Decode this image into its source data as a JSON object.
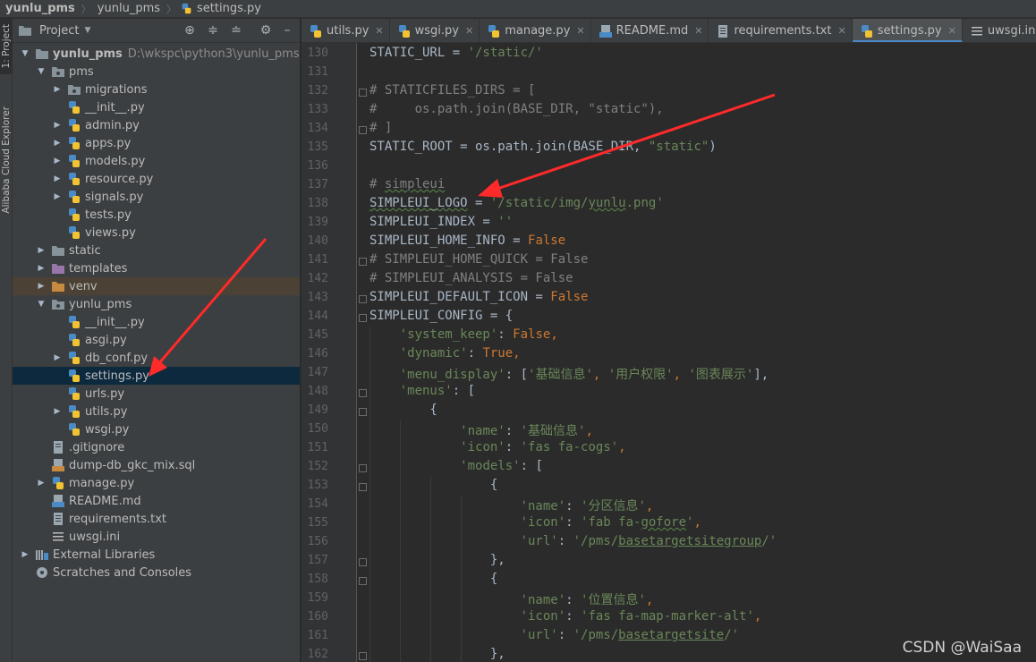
{
  "breadcrumb": [
    "yunlu_pms",
    "yunlu_pms",
    "settings.py"
  ],
  "toolstrip": {
    "project_label": "1: Project",
    "alibaba_label": "Alibaba Cloud Explorer"
  },
  "panel": {
    "title": "Project",
    "tree": [
      {
        "depth": 0,
        "chev": "down",
        "icon": "folder-icon",
        "label": "yunlu_pms",
        "bold": true,
        "path": "D:\\wkspc\\python3\\yunlu_pms"
      },
      {
        "depth": 1,
        "chev": "down",
        "icon": "package-icon",
        "label": "pms"
      },
      {
        "depth": 2,
        "chev": "right",
        "icon": "package-icon",
        "label": "migrations"
      },
      {
        "depth": 2,
        "chev": "",
        "icon": "python-icon",
        "label": "__init__.py"
      },
      {
        "depth": 2,
        "chev": "right",
        "icon": "python-icon",
        "label": "admin.py"
      },
      {
        "depth": 2,
        "chev": "right",
        "icon": "python-icon",
        "label": "apps.py"
      },
      {
        "depth": 2,
        "chev": "right",
        "icon": "python-icon",
        "label": "models.py"
      },
      {
        "depth": 2,
        "chev": "right",
        "icon": "python-icon",
        "label": "resource.py"
      },
      {
        "depth": 2,
        "chev": "right",
        "icon": "python-icon",
        "label": "signals.py"
      },
      {
        "depth": 2,
        "chev": "",
        "icon": "python-icon",
        "label": "tests.py"
      },
      {
        "depth": 2,
        "chev": "",
        "icon": "python-icon",
        "label": "views.py"
      },
      {
        "depth": 1,
        "chev": "right",
        "icon": "folder-icon",
        "label": "static"
      },
      {
        "depth": 1,
        "chev": "right",
        "icon": "template-folder-icon",
        "label": "templates"
      },
      {
        "depth": 1,
        "chev": "right",
        "icon": "excluded-folder-icon",
        "label": "venv",
        "highlight": "venv"
      },
      {
        "depth": 1,
        "chev": "down",
        "icon": "package-icon",
        "label": "yunlu_pms"
      },
      {
        "depth": 2,
        "chev": "",
        "icon": "python-icon",
        "label": "__init__.py"
      },
      {
        "depth": 2,
        "chev": "",
        "icon": "python-icon",
        "label": "asgi.py"
      },
      {
        "depth": 2,
        "chev": "right",
        "icon": "python-icon",
        "label": "db_conf.py"
      },
      {
        "depth": 2,
        "chev": "",
        "icon": "python-icon",
        "label": "settings.py",
        "highlight": "selected"
      },
      {
        "depth": 2,
        "chev": "",
        "icon": "python-icon",
        "label": "urls.py"
      },
      {
        "depth": 2,
        "chev": "right",
        "icon": "python-icon",
        "label": "utils.py"
      },
      {
        "depth": 2,
        "chev": "",
        "icon": "python-icon",
        "label": "wsgi.py"
      },
      {
        "depth": 1,
        "chev": "",
        "icon": "gitignore-icon",
        "label": ".gitignore"
      },
      {
        "depth": 1,
        "chev": "",
        "icon": "sql-icon",
        "label": "dump-db_gkc_mix.sql"
      },
      {
        "depth": 1,
        "chev": "right",
        "icon": "python-icon",
        "label": "manage.py"
      },
      {
        "depth": 1,
        "chev": "",
        "icon": "markdown-icon",
        "label": "README.md"
      },
      {
        "depth": 1,
        "chev": "",
        "icon": "text-file-icon",
        "label": "requirements.txt"
      },
      {
        "depth": 1,
        "chev": "",
        "icon": "ini-file-icon",
        "label": "uwsgi.ini"
      },
      {
        "depth": 0,
        "chev": "right",
        "icon": "libraries-icon",
        "label": "External Libraries"
      },
      {
        "depth": 0,
        "chev": "",
        "icon": "scratches-icon",
        "label": "Scratches and Consoles"
      }
    ]
  },
  "tabs": [
    {
      "label": "utils.py",
      "icon": "python-icon",
      "active": false
    },
    {
      "label": "wsgi.py",
      "icon": "python-icon",
      "active": false
    },
    {
      "label": "manage.py",
      "icon": "python-icon",
      "active": false
    },
    {
      "label": "README.md",
      "icon": "markdown-icon",
      "active": false
    },
    {
      "label": "requirements.txt",
      "icon": "text-file-icon",
      "active": false
    },
    {
      "label": "settings.py",
      "icon": "python-icon",
      "active": true
    },
    {
      "label": "uwsgi.ini",
      "icon": "ini-file-icon",
      "active": false
    }
  ],
  "editor": {
    "lines": [
      {
        "n": "130",
        "tokens": [
          [
            "id",
            "STATIC_URL = "
          ],
          [
            "str",
            "'/static/'"
          ]
        ]
      },
      {
        "n": "131",
        "tokens": []
      },
      {
        "n": "132",
        "fold": true,
        "tokens": [
          [
            "com",
            "# STATICFILES_DIRS = ["
          ]
        ]
      },
      {
        "n": "133",
        "tokens": [
          [
            "com",
            "#     os.path.join(BASE_DIR, \"static\"),"
          ]
        ]
      },
      {
        "n": "134",
        "fold": true,
        "tokens": [
          [
            "com",
            "# ]"
          ]
        ]
      },
      {
        "n": "135",
        "tokens": [
          [
            "id",
            "STATIC_ROOT = os.path.join(BASE_DIR, "
          ],
          [
            "str",
            "\"static\""
          ],
          [
            "id",
            ")"
          ]
        ]
      },
      {
        "n": "136",
        "tokens": []
      },
      {
        "n": "137",
        "tokens": [
          [
            "com",
            "# "
          ],
          [
            "comsq",
            "simpleui"
          ]
        ]
      },
      {
        "n": "138",
        "tokens": [
          [
            "sq",
            "SIMPLEUI_LOGO"
          ],
          [
            "id",
            " = "
          ],
          [
            "str",
            "'/static/img/"
          ],
          [
            "strsq",
            "yunlu"
          ],
          [
            "str",
            ".png'"
          ]
        ]
      },
      {
        "n": "139",
        "tokens": [
          [
            "id",
            "SIMPLEUI_INDEX = "
          ],
          [
            "str",
            "''"
          ]
        ]
      },
      {
        "n": "140",
        "tokens": [
          [
            "id",
            "SIMPLEUI_HOME_INFO = "
          ],
          [
            "kw",
            "False"
          ]
        ]
      },
      {
        "n": "141",
        "fold": true,
        "tokens": [
          [
            "com",
            "# SIMPLEUI_HOME_QUICK = False"
          ]
        ]
      },
      {
        "n": "142",
        "tokens": [
          [
            "com",
            "# SIMPLEUI_ANALYSIS = False"
          ]
        ]
      },
      {
        "n": "143",
        "fold": true,
        "tokens": [
          [
            "id",
            "SIMPLEUI_DEFAULT_ICON = "
          ],
          [
            "kw",
            "False"
          ]
        ]
      },
      {
        "n": "144",
        "fold": true,
        "tokens": [
          [
            "id",
            "SIMPLEUI_CONFIG = {"
          ]
        ]
      },
      {
        "n": "145",
        "tokens": [
          [
            "id",
            "    "
          ],
          [
            "str",
            "'system_keep'"
          ],
          [
            "id",
            ": "
          ],
          [
            "kw",
            "False"
          ],
          [
            "kw",
            ","
          ]
        ]
      },
      {
        "n": "146",
        "tokens": [
          [
            "id",
            "    "
          ],
          [
            "str",
            "'dynamic'"
          ],
          [
            "id",
            ": "
          ],
          [
            "kw",
            "True"
          ],
          [
            "kw",
            ","
          ]
        ]
      },
      {
        "n": "147",
        "tokens": [
          [
            "id",
            "    "
          ],
          [
            "str",
            "'menu_display'"
          ],
          [
            "id",
            ": ["
          ],
          [
            "str",
            "'基础信息'"
          ],
          [
            "kw",
            ", "
          ],
          [
            "str",
            "'用户权限'"
          ],
          [
            "kw",
            ", "
          ],
          [
            "str",
            "'图表展示'"
          ],
          [
            "id",
            "],"
          ]
        ]
      },
      {
        "n": "148",
        "fold": true,
        "tokens": [
          [
            "id",
            "    "
          ],
          [
            "str",
            "'menus'"
          ],
          [
            "id",
            ": ["
          ]
        ]
      },
      {
        "n": "149",
        "fold": true,
        "tokens": [
          [
            "id",
            "        {"
          ]
        ]
      },
      {
        "n": "150",
        "tokens": [
          [
            "id",
            "            "
          ],
          [
            "str",
            "'name'"
          ],
          [
            "id",
            ": "
          ],
          [
            "str",
            "'基础信息'"
          ],
          [
            "kw",
            ","
          ]
        ]
      },
      {
        "n": "151",
        "tokens": [
          [
            "id",
            "            "
          ],
          [
            "str",
            "'icon'"
          ],
          [
            "id",
            ": "
          ],
          [
            "str",
            "'fas fa-cogs'"
          ],
          [
            "kw",
            ","
          ]
        ]
      },
      {
        "n": "152",
        "fold": true,
        "tokens": [
          [
            "id",
            "            "
          ],
          [
            "str",
            "'models'"
          ],
          [
            "id",
            ": ["
          ]
        ]
      },
      {
        "n": "153",
        "fold": true,
        "tokens": [
          [
            "id",
            "                {"
          ]
        ]
      },
      {
        "n": "154",
        "tokens": [
          [
            "id",
            "                    "
          ],
          [
            "str",
            "'name'"
          ],
          [
            "id",
            ": "
          ],
          [
            "str",
            "'分区信息'"
          ],
          [
            "kw",
            ","
          ]
        ]
      },
      {
        "n": "155",
        "tokens": [
          [
            "id",
            "                    "
          ],
          [
            "str",
            "'icon'"
          ],
          [
            "id",
            ": "
          ],
          [
            "str",
            "'fab fa-"
          ],
          [
            "strsq",
            "gofore"
          ],
          [
            "str",
            "'"
          ],
          [
            "kw",
            ","
          ]
        ]
      },
      {
        "n": "156",
        "tokens": [
          [
            "id",
            "                    "
          ],
          [
            "str",
            "'url'"
          ],
          [
            "id",
            ": "
          ],
          [
            "str",
            "'/pms/"
          ],
          [
            "strul",
            "basetargetsitegroup"
          ],
          [
            "str",
            "/'"
          ]
        ]
      },
      {
        "n": "157",
        "fold": true,
        "tokens": [
          [
            "id",
            "                },"
          ]
        ]
      },
      {
        "n": "158",
        "fold": true,
        "tokens": [
          [
            "id",
            "                {"
          ]
        ]
      },
      {
        "n": "159",
        "tokens": [
          [
            "id",
            "                    "
          ],
          [
            "str",
            "'name'"
          ],
          [
            "id",
            ": "
          ],
          [
            "str",
            "'位置信息'"
          ],
          [
            "kw",
            ","
          ]
        ]
      },
      {
        "n": "160",
        "tokens": [
          [
            "id",
            "                    "
          ],
          [
            "str",
            "'icon'"
          ],
          [
            "id",
            ": "
          ],
          [
            "str",
            "'fas fa-map-marker-alt'"
          ],
          [
            "kw",
            ","
          ]
        ]
      },
      {
        "n": "161",
        "tokens": [
          [
            "id",
            "                    "
          ],
          [
            "str",
            "'url'"
          ],
          [
            "id",
            ": "
          ],
          [
            "str",
            "'/pms/"
          ],
          [
            "strul",
            "basetargetsite"
          ],
          [
            "str",
            "/'"
          ]
        ]
      },
      {
        "n": "162",
        "fold": true,
        "tokens": [
          [
            "id",
            "                },"
          ]
        ]
      }
    ]
  },
  "watermark": "CSDN @WaiSaa",
  "colors": {
    "annotation_arrow": "#ff2a2a",
    "selection": "#0d293e",
    "tab_accent": "#4a88c7"
  }
}
